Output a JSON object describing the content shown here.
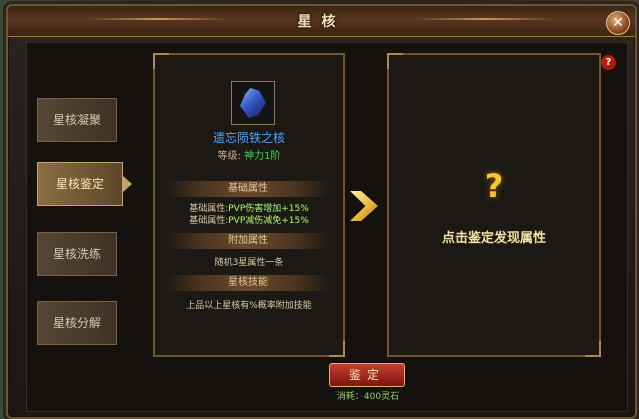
{
  "title": "星核",
  "close": "✕",
  "help": "?",
  "tabs": [
    {
      "label": "星核凝聚",
      "active": false
    },
    {
      "label": "星核鉴定",
      "active": true
    },
    {
      "label": "星核洗练",
      "active": false
    },
    {
      "label": "星核分解",
      "active": false
    }
  ],
  "item": {
    "name": "遗忘陨铁之核",
    "level_label": "等级:",
    "level_value": "神力1阶",
    "icon": "crystal-icon"
  },
  "sections": {
    "base": "基础属性",
    "extra": "附加属性",
    "skill": "星核技能"
  },
  "base_attrs": [
    {
      "label": "基础属性:",
      "value": "PVP伤害增加+15%"
    },
    {
      "label": "基础属性:",
      "value": "PVP减伤减免+15%"
    }
  ],
  "extra_attr": "随机3星属性一条",
  "skill_attr": "上品以上星核有%概率附加技能",
  "identify": {
    "question": "?",
    "hint": "点击鉴定发现属性"
  },
  "confirm": "鉴定",
  "cost": "消耗：400灵石",
  "colors": {
    "accent": "#b08a4b",
    "item_name": "#49a5ff",
    "value_green": "#aefc6e"
  }
}
